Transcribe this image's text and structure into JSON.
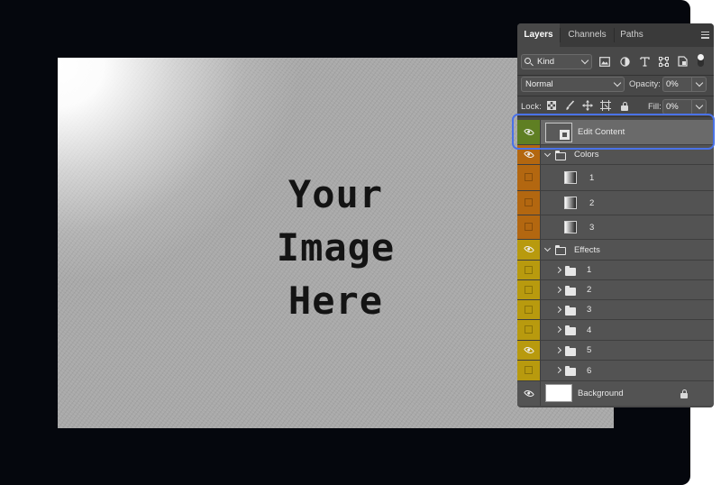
{
  "canvas": {
    "lines": [
      "Your",
      "Image",
      "Here"
    ]
  },
  "panel": {
    "tabs": [
      {
        "label": "Layers",
        "active": true
      },
      {
        "label": "Channels",
        "active": false
      },
      {
        "label": "Paths",
        "active": false
      }
    ],
    "filter": {
      "kind_label": "Kind"
    },
    "blend_mode": "Normal",
    "opacity": {
      "label": "Opacity:",
      "value": "0%"
    },
    "lock_label": "Lock:",
    "fill": {
      "label": "Fill:",
      "value": "0%"
    },
    "layers": [
      {
        "name": "Edit Content",
        "type": "smart-object",
        "visibility": "green",
        "visible": true,
        "selected": true
      },
      {
        "name": "Colors",
        "type": "group-open",
        "visibility": "orange",
        "visible": true
      },
      {
        "name": "1",
        "type": "gradient",
        "visibility": "orange",
        "visible": false
      },
      {
        "name": "2",
        "type": "gradient",
        "visibility": "orange",
        "visible": false
      },
      {
        "name": "3",
        "type": "gradient",
        "visibility": "orange",
        "visible": false
      },
      {
        "name": "Effects",
        "type": "group-open",
        "visibility": "yellow",
        "visible": true
      },
      {
        "name": "1",
        "type": "group-closed",
        "visibility": "yellow",
        "visible": false
      },
      {
        "name": "2",
        "type": "group-closed",
        "visibility": "yellow",
        "visible": false
      },
      {
        "name": "3",
        "type": "group-closed",
        "visibility": "yellow",
        "visible": false
      },
      {
        "name": "4",
        "type": "group-closed",
        "visibility": "yellow",
        "visible": false
      },
      {
        "name": "5",
        "type": "group-closed",
        "visibility": "yellow",
        "visible": true
      },
      {
        "name": "6",
        "type": "group-closed",
        "visibility": "yellow",
        "visible": false
      },
      {
        "name": "Background",
        "type": "background",
        "visibility": "gray",
        "visible": true,
        "locked": true
      }
    ]
  },
  "colors": {
    "highlight": "#4a72e8",
    "panel_bg": "#484848",
    "vis_green": "#5f7f23",
    "vis_orange": "#b36710",
    "vis_yellow": "#b89a0e"
  }
}
